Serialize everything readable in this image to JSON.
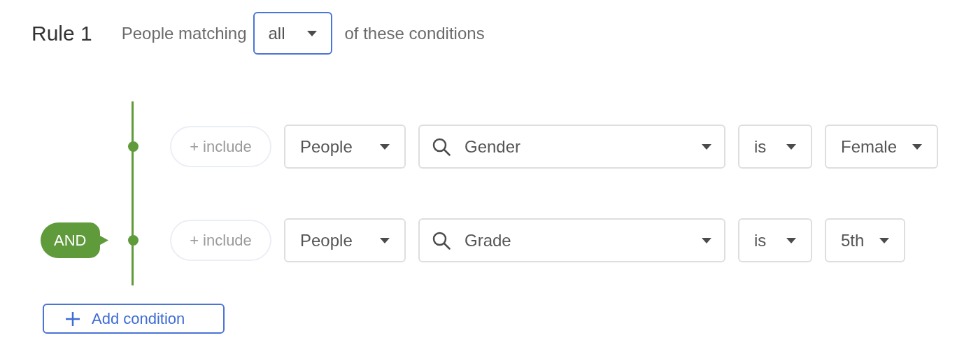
{
  "rule": {
    "title": "Rule 1",
    "prefix": "People matching",
    "match": "all",
    "suffix": "of these conditions"
  },
  "conjunction": "AND",
  "conditions": [
    {
      "include": "+ include",
      "entity": "People",
      "field": "Gender",
      "operator": "is",
      "value": "Female"
    },
    {
      "include": "+ include",
      "entity": "People",
      "field": "Grade",
      "operator": "is",
      "value": "5th"
    }
  ],
  "add_button": "Add condition"
}
